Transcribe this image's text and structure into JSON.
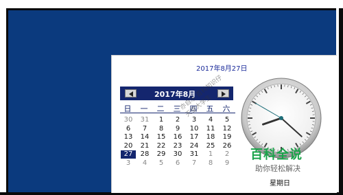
{
  "header": {
    "date_text": "2017年8月27日"
  },
  "calendar": {
    "title": "2017年8月",
    "weekdays": [
      "日",
      "一",
      "二",
      "三",
      "四",
      "五",
      "六"
    ],
    "weeks": [
      [
        {
          "d": "30",
          "o": true
        },
        {
          "d": "31",
          "o": true
        },
        {
          "d": "1"
        },
        {
          "d": "2"
        },
        {
          "d": "3"
        },
        {
          "d": "4"
        },
        {
          "d": "5"
        }
      ],
      [
        {
          "d": "6"
        },
        {
          "d": "7"
        },
        {
          "d": "8"
        },
        {
          "d": "9"
        },
        {
          "d": "10"
        },
        {
          "d": "11"
        },
        {
          "d": "12"
        }
      ],
      [
        {
          "d": "13"
        },
        {
          "d": "14"
        },
        {
          "d": "15"
        },
        {
          "d": "16"
        },
        {
          "d": "17"
        },
        {
          "d": "18"
        },
        {
          "d": "19"
        }
      ],
      [
        {
          "d": "20"
        },
        {
          "d": "21"
        },
        {
          "d": "22"
        },
        {
          "d": "23"
        },
        {
          "d": "24"
        },
        {
          "d": "25"
        },
        {
          "d": "26"
        }
      ],
      [
        {
          "d": "27",
          "s": true
        },
        {
          "d": "28"
        },
        {
          "d": "29"
        },
        {
          "d": "30"
        },
        {
          "d": "31"
        },
        {
          "d": "1",
          "o": true
        },
        {
          "d": "2",
          "o": true
        }
      ],
      [
        {
          "d": "3",
          "o": true
        },
        {
          "d": "4",
          "o": true
        },
        {
          "d": "5",
          "o": true
        },
        {
          "d": "6",
          "o": true
        },
        {
          "d": "7",
          "o": true
        },
        {
          "d": "8",
          "o": true
        },
        {
          "d": "9",
          "o": true
        }
      ]
    ],
    "prev_icon": "triangle-left-icon",
    "next_icon": "triangle-right-icon"
  },
  "clock": {
    "hour": 8,
    "minute": 22,
    "second": 50,
    "icon": "analog-clock-icon"
  },
  "watermark": {
    "line1": "亦自乐 百科知识仔",
    "line2": "天空大学生"
  },
  "brand": {
    "title": "百科全说",
    "subtitle": "助你轻松解决"
  },
  "footer": {
    "weekday": "星期日"
  },
  "colors": {
    "desktop": "#0b3a7e",
    "calendar_header": "#14266e",
    "brand_green": "#1aa34a"
  }
}
